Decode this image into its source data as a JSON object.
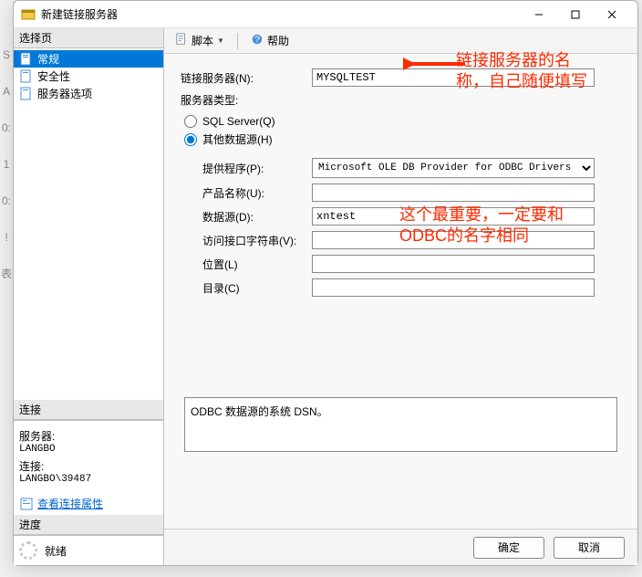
{
  "window": {
    "title": "新建链接服务器"
  },
  "toolbar": {
    "script": "脚本",
    "help": "帮助"
  },
  "nav": {
    "header": "选择页",
    "items": [
      "常规",
      "安全性",
      "服务器选项"
    ],
    "selected": 0
  },
  "connection": {
    "header": "连接",
    "server_label": "服务器:",
    "server_value": "LANGBO",
    "conn_label": "连接:",
    "conn_value": "LANGBO\\39487",
    "view_props": "查看连接属性"
  },
  "progress": {
    "header": "进度",
    "status": "就绪"
  },
  "form": {
    "linked_server_label": "链接服务器(N):",
    "linked_server_value": "MYSQLTEST",
    "server_type_label": "服务器类型:",
    "radio_sql": "SQL Server(Q)",
    "radio_other": "其他数据源(H)",
    "provider_label": "提供程序(P):",
    "provider_value": "Microsoft OLE DB Provider for ODBC Drivers",
    "product_label": "产品名称(U):",
    "product_value": "",
    "datasource_label": "数据源(D):",
    "datasource_value": "xntest",
    "connstr_label": "访问接口字符串(V):",
    "connstr_value": "",
    "location_label": "位置(L)",
    "location_value": "",
    "catalog_label": "目录(C)",
    "catalog_value": ""
  },
  "desc": "ODBC 数据源的系统 DSN。",
  "buttons": {
    "ok": "确定",
    "cancel": "取消"
  },
  "annotations": {
    "a1": "链接服务器的名称，自己随便填写",
    "a2": "这个最重要，一定要和ODBC的名字相同"
  }
}
